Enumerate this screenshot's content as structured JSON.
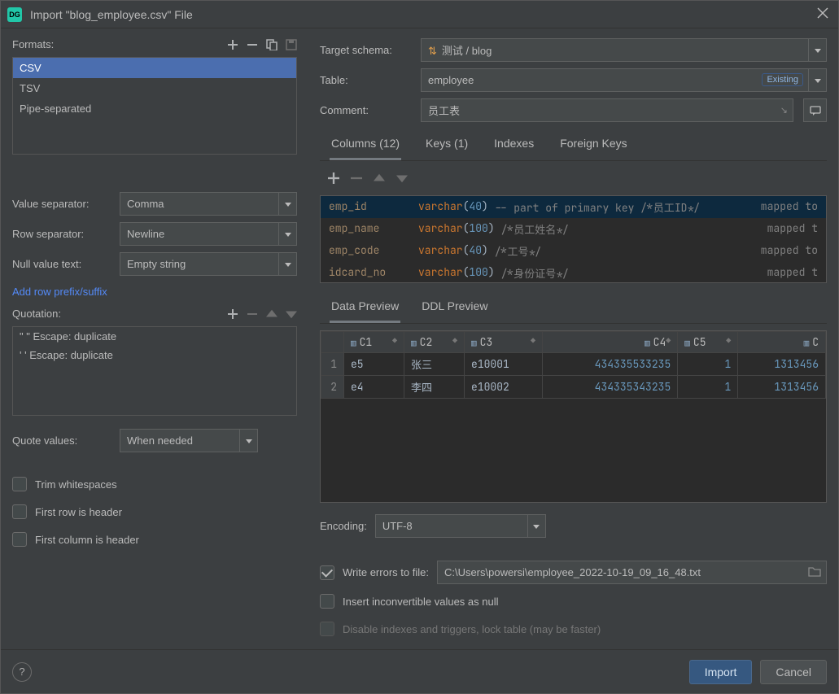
{
  "window": {
    "title": "Import \"blog_employee.csv\" File"
  },
  "formats": {
    "label": "Formats:",
    "items": [
      "CSV",
      "TSV",
      "Pipe-separated"
    ],
    "selected": 0
  },
  "separators": {
    "value_label": "Value separator:",
    "value": "Comma",
    "row_label": "Row separator:",
    "row": "Newline",
    "null_label": "Null value text:",
    "null": "Empty string"
  },
  "add_prefix_link": "Add row prefix/suffix",
  "quotation": {
    "label": "Quotation:",
    "items": [
      "\"  \"  Escape: duplicate",
      "'  '  Escape: duplicate"
    ]
  },
  "quote_values": {
    "label": "Quote values:",
    "value": "When needed"
  },
  "options": {
    "trim": "Trim whitespaces",
    "first_row": "First row is header",
    "first_col": "First column is header"
  },
  "target": {
    "schema_label": "Target schema:",
    "schema": "测试 / blog",
    "table_label": "Table:",
    "table": "employee",
    "table_badge": "Existing",
    "comment_label": "Comment:",
    "comment": "员工表"
  },
  "column_tabs": {
    "columns": "Columns (12)",
    "keys": "Keys (1)",
    "indexes": "Indexes",
    "fks": "Foreign Keys"
  },
  "columns": [
    {
      "name": "emp_id",
      "type": "varchar",
      "len": "40",
      "comment": "-- part of primary key /*员工ID*/",
      "map": "mapped to"
    },
    {
      "name": "emp_name",
      "type": "varchar",
      "len": "100",
      "comment": "/*员工姓名*/",
      "map": "mapped t"
    },
    {
      "name": "emp_code",
      "type": "varchar",
      "len": "40",
      "comment": "/*工号*/",
      "map": "mapped to"
    },
    {
      "name": "idcard_no",
      "type": "varchar",
      "len": "100",
      "comment": "/*身份证号*/",
      "map": "mapped t"
    }
  ],
  "preview_tabs": {
    "data": "Data Preview",
    "ddl": "DDL Preview"
  },
  "preview": {
    "headers": [
      "C1",
      "C2",
      "C3",
      "C4",
      "C5",
      "C"
    ],
    "rows": [
      {
        "n": "1",
        "c1": "e5",
        "c2": "张三",
        "c3": "e10001",
        "c4": "434335533235",
        "c5": "1",
        "c6": "1313456"
      },
      {
        "n": "2",
        "c1": "e4",
        "c2": "李四",
        "c3": "e10002",
        "c4": "434335343235",
        "c5": "1",
        "c6": "1313456"
      }
    ]
  },
  "encoding": {
    "label": "Encoding:",
    "value": "UTF-8"
  },
  "errfile": {
    "checkbox_label": "Write errors to file:",
    "path": "C:\\Users\\powersi\\employee_2022-10-19_09_16_48.txt"
  },
  "insert_null": "Insert inconvertible values as null",
  "disable_idx": "Disable indexes and triggers, lock table (may be faster)",
  "buttons": {
    "import": "Import",
    "cancel": "Cancel"
  }
}
